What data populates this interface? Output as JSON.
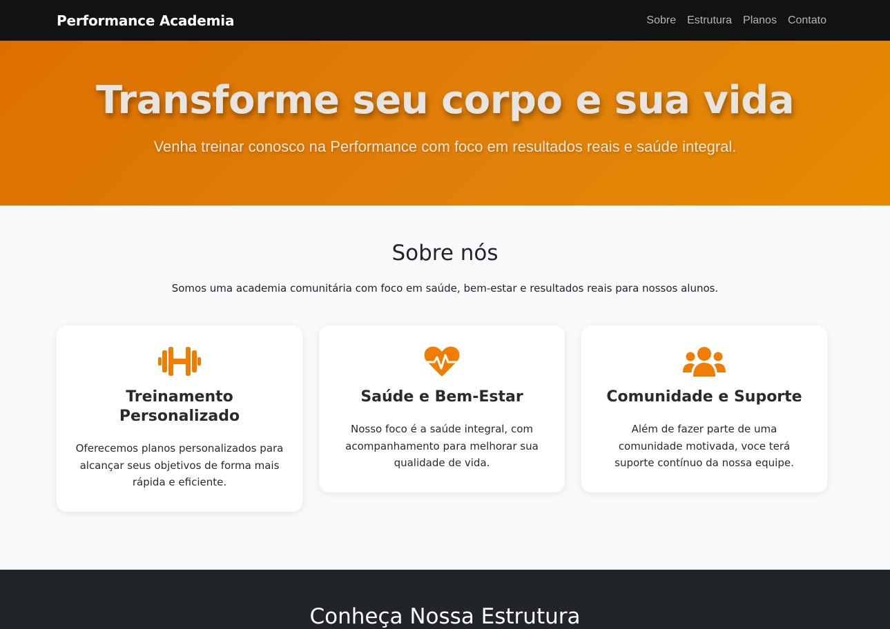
{
  "nav": {
    "brand": "Performance Academia",
    "links": [
      "Sobre",
      "Estrutura",
      "Planos",
      "Contato"
    ]
  },
  "hero": {
    "title": "Transforme seu corpo e sua vida",
    "subtitle": "Venha treinar conosco na Performance com foco em resultados reais e saúde integral."
  },
  "about": {
    "title": "Sobre nós",
    "text": "Somos uma academia comunitária com foco em saúde, bem-estar e resultados reais para nossos alunos.",
    "cards": [
      {
        "icon": "dumbbell-icon",
        "title": "Treinamento Personalizado",
        "text": "Oferecemos planos personalizados para alcançar seus objetivos de forma mais rápida e eficiente."
      },
      {
        "icon": "heart-pulse-icon",
        "title": "Saúde e Bem-Estar",
        "text": "Nosso foco é a saúde integral, com acompanhamento para melhorar sua qualidade de vida."
      },
      {
        "icon": "users-icon",
        "title": "Comunidade e Suporte",
        "text": "Além de fazer parte de uma comunidade motivada, voce terá suporte contínuo da nossa equipe."
      }
    ]
  },
  "structure": {
    "title": "Conheça Nossa Estrutura"
  },
  "colors": {
    "accent": "#f07c00",
    "navbar": "#111213",
    "dark_section": "#212529"
  }
}
